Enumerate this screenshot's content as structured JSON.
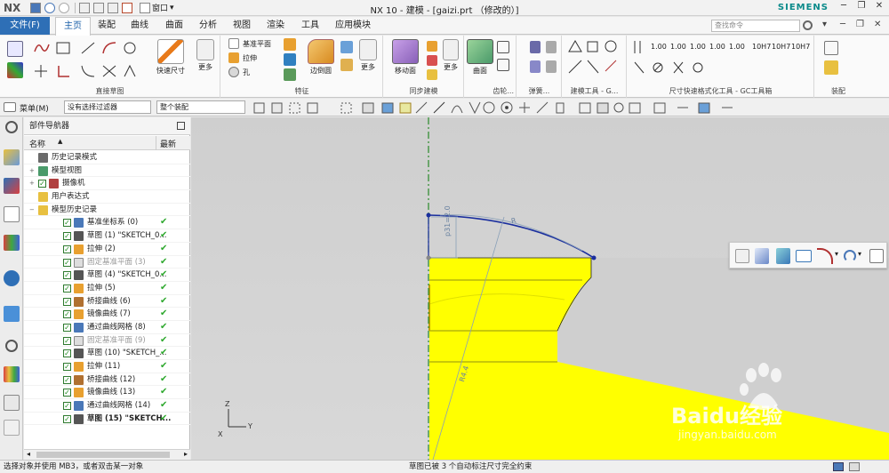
{
  "titlebar": {
    "logo": "NX",
    "window_menu": "窗口",
    "title": "NX 10 - 建模 - [gaizi.prt （修改的）]",
    "brand": "SIEMENS"
  },
  "tabs": {
    "file": "文件(F)",
    "items": [
      "主页",
      "装配",
      "曲线",
      "曲面",
      "分析",
      "视图",
      "渲染",
      "工具",
      "应用模块"
    ],
    "search_placeholder": "查找命令"
  },
  "ribbon": {
    "groups": {
      "sketch": "直接草图",
      "feature": "特征",
      "sync": "同步建模",
      "gear": "齿轮...",
      "spring": "弹簧...",
      "modeling_tools": "建模工具 - G...",
      "dim_tool": "尺寸快速格式化工具 - GC工具箱",
      "assembly": "装配"
    },
    "buttons": {
      "quick_dim": "快速尺寸",
      "more_1": "更多",
      "datum_plane": "基准平面",
      "extrude": "拉伸",
      "hole": "孔",
      "edge_blend": "边倒圆",
      "more_2": "更多",
      "move_face": "移动面",
      "more_3": "更多",
      "surface": "曲面",
      "more_4": "更多"
    },
    "dim_labels": [
      "1.00",
      "1.00",
      "1.00",
      "1.00",
      "1.00",
      "10H7",
      "10H7",
      "10H7"
    ]
  },
  "selection": {
    "menu": "菜单(M)",
    "filter": "没有选择过滤器",
    "scope": "整个装配"
  },
  "navigator": {
    "title": "部件导航器",
    "col_name": "名称",
    "col_latest": "最新",
    "rows": [
      {
        "label": "历史记录模式",
        "indent": 0,
        "check": false,
        "tick": false,
        "dim": false,
        "bold": false,
        "icon": "clock-icon"
      },
      {
        "label": "模型视图",
        "indent": 0,
        "check": false,
        "tick": false,
        "dim": false,
        "bold": false,
        "icon": "model-view-icon"
      },
      {
        "label": "摄像机",
        "indent": 0,
        "check": true,
        "tick": false,
        "dim": false,
        "bold": false,
        "icon": "camera-icon"
      },
      {
        "label": "用户表达式",
        "indent": 0,
        "check": false,
        "tick": false,
        "dim": false,
        "bold": false,
        "icon": "folder-icon"
      },
      {
        "label": "模型历史记录",
        "indent": 0,
        "check": false,
        "tick": false,
        "dim": false,
        "bold": false,
        "icon": "folder-icon"
      },
      {
        "label": "基准坐标系 (0)",
        "indent": 1,
        "check": true,
        "tick": true,
        "dim": false,
        "bold": false,
        "icon": "datum-csys-icon"
      },
      {
        "label": "草图 (1) \"SKETCH_0...",
        "indent": 1,
        "check": true,
        "tick": true,
        "dim": false,
        "bold": false,
        "icon": "sketch-icon"
      },
      {
        "label": "拉伸 (2)",
        "indent": 1,
        "check": true,
        "tick": true,
        "dim": false,
        "bold": false,
        "icon": "extrude-icon"
      },
      {
        "label": "固定基准平面 (3)",
        "indent": 1,
        "check": true,
        "tick": true,
        "dim": true,
        "bold": false,
        "icon": "datum-plane-icon"
      },
      {
        "label": "草图 (4) \"SKETCH_0...",
        "indent": 1,
        "check": true,
        "tick": true,
        "dim": false,
        "bold": false,
        "icon": "sketch-icon"
      },
      {
        "label": "拉伸 (5)",
        "indent": 1,
        "check": true,
        "tick": true,
        "dim": false,
        "bold": false,
        "icon": "extrude-icon"
      },
      {
        "label": "桥接曲线 (6)",
        "indent": 1,
        "check": true,
        "tick": true,
        "dim": false,
        "bold": false,
        "icon": "bridge-curve-icon"
      },
      {
        "label": "镜像曲线 (7)",
        "indent": 1,
        "check": true,
        "tick": true,
        "dim": false,
        "bold": false,
        "icon": "mirror-curve-icon"
      },
      {
        "label": "通过曲线网格 (8)",
        "indent": 1,
        "check": true,
        "tick": true,
        "dim": false,
        "bold": false,
        "icon": "mesh-surface-icon"
      },
      {
        "label": "固定基准平面 (9)",
        "indent": 1,
        "check": true,
        "tick": true,
        "dim": true,
        "bold": false,
        "icon": "datum-plane-icon"
      },
      {
        "label": "草图 (10) \"SKETCH_...",
        "indent": 1,
        "check": true,
        "tick": true,
        "dim": false,
        "bold": false,
        "icon": "sketch-icon"
      },
      {
        "label": "拉伸 (11)",
        "indent": 1,
        "check": true,
        "tick": true,
        "dim": false,
        "bold": false,
        "icon": "extrude-icon"
      },
      {
        "label": "桥接曲线 (12)",
        "indent": 1,
        "check": true,
        "tick": true,
        "dim": false,
        "bold": false,
        "icon": "bridge-curve-icon"
      },
      {
        "label": "镜像曲线 (13)",
        "indent": 1,
        "check": true,
        "tick": true,
        "dim": false,
        "bold": false,
        "icon": "mirror-curve-icon"
      },
      {
        "label": "通过曲线网格 (14)",
        "indent": 1,
        "check": true,
        "tick": true,
        "dim": false,
        "bold": false,
        "icon": "mesh-surface-icon"
      },
      {
        "label": "草图 (15) \"SKETCH...",
        "indent": 1,
        "check": true,
        "tick": true,
        "dim": false,
        "bold": true,
        "icon": "sketch-icon"
      }
    ]
  },
  "viewport": {
    "dim_vertical": "p31=2.0",
    "dim_arc": "R",
    "dim_radius": "R4.4",
    "triad_z": "Z",
    "triad_y": "Y",
    "triad_x": "X"
  },
  "watermark": {
    "brand": "Baidu经验",
    "url": "jingyan.baidu.com"
  },
  "status": {
    "left": "选择对象并使用 MB3，或者双击某一对象",
    "center": "草图已被 3 个自动标注尺寸完全约束"
  },
  "colors": {
    "accent": "#2e6fb6",
    "model_yellow": "#ffff00",
    "sketch_blue": "#1a2e9e",
    "check_green": "#2ea82e"
  }
}
